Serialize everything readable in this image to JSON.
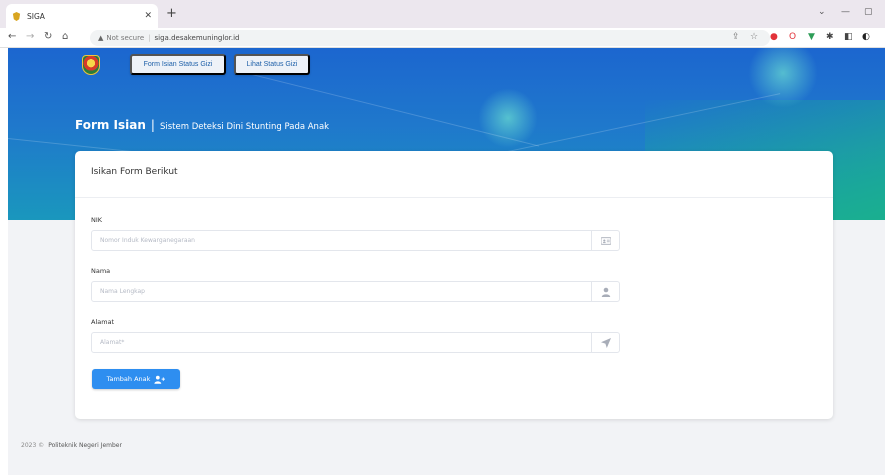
{
  "browser": {
    "tab_title": "SIGA",
    "url_security": "Not secure",
    "url": "siga.desakemuninglor.id"
  },
  "nav": {
    "buttons": [
      "Form Isian Status Gizi",
      "Lihat Status Gizi"
    ]
  },
  "hero": {
    "title": "Form Isian",
    "separator": "|",
    "subtitle": "Sistem Deteksi Dini Stunting Pada Anak"
  },
  "form": {
    "card_title": "Isikan Form Berikut",
    "fields": [
      {
        "label": "NIK",
        "placeholder": "Nomor Induk Kewarganegaraan",
        "icon": "id-card-icon"
      },
      {
        "label": "Nama",
        "placeholder": "Nama Lengkap",
        "icon": "user-icon"
      },
      {
        "label": "Alamat",
        "placeholder": "Alamat*",
        "icon": "location-arrow-icon"
      }
    ],
    "submit_label": "Tambah Anak"
  },
  "footer": {
    "year": "2023 ©",
    "org": "Politeknik Negeri Jember"
  },
  "colors": {
    "hero_blue": "#1c66cf",
    "hero_teal": "#1aaf8f",
    "button_blue": "#2e8ef0",
    "page_bg": "#f2f3f6"
  }
}
